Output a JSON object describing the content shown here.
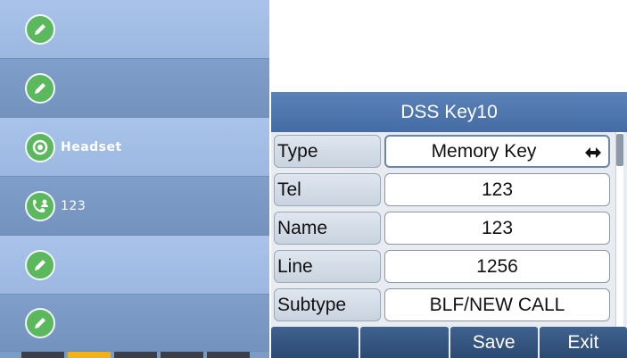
{
  "dss_keys": [
    {
      "icon": "pencil-icon",
      "label": ""
    },
    {
      "icon": "pencil-icon",
      "label": ""
    },
    {
      "icon": "headset-icon",
      "label": "Headset"
    },
    {
      "icon": "contact-phone-icon",
      "label": "123"
    },
    {
      "icon": "pencil-icon",
      "label": ""
    },
    {
      "icon": "pencil-icon",
      "label": ""
    }
  ],
  "page_indicator": {
    "pages": 5,
    "active_page": 2
  },
  "panel": {
    "title": "DSS  Key10",
    "fields": [
      {
        "label": "Type",
        "value": "Memory  Key"
      },
      {
        "label": "Tel",
        "value": "123"
      },
      {
        "label": "Name",
        "value": "123"
      },
      {
        "label": "Line",
        "value": "1256"
      },
      {
        "label": "Subtype",
        "value": "BLF/NEW  CALL"
      }
    ],
    "softkeys": [
      "",
      "",
      "Save",
      "Exit"
    ]
  },
  "colors": {
    "key_icon_green": "#5cb85c",
    "title_bar": "#446ca4",
    "softkey_bg": "#2b4a73",
    "active_page": "#f2b215"
  }
}
